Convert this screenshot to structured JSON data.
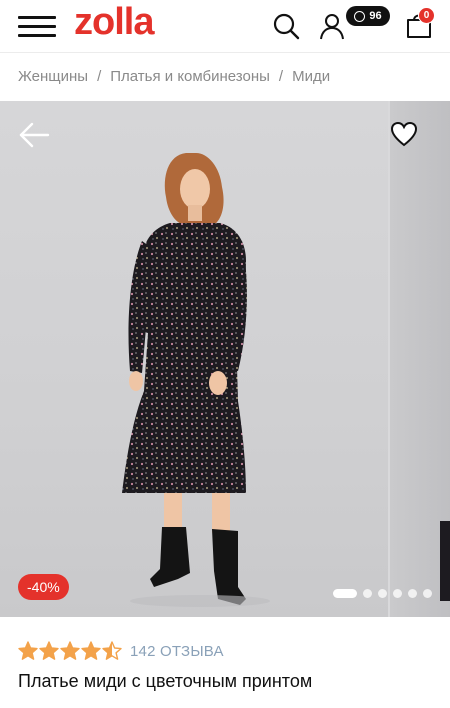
{
  "header": {
    "logo": "zolla",
    "bonus_count": "96",
    "cart_count": "0"
  },
  "breadcrumb": {
    "items": [
      "Женщины",
      "Платья и комбинезоны",
      "Миди"
    ],
    "separator": "/"
  },
  "gallery": {
    "discount_label": "-40%",
    "total_slides": 6,
    "active_slide": 1
  },
  "product": {
    "rating": 4.5,
    "rating_max": 5,
    "reviews_label": "142 ОТЗЫВА",
    "title": "Платье миди с цветочным принтом"
  },
  "colors": {
    "brand": "#e4322b",
    "reviews_link": "#8aa1b8",
    "star": "#f3a24a"
  },
  "icons": [
    "burger-menu-icon",
    "search-icon",
    "user-icon",
    "bonus-icon",
    "cart-icon",
    "back-arrow-icon",
    "heart-icon",
    "star-icon"
  ]
}
